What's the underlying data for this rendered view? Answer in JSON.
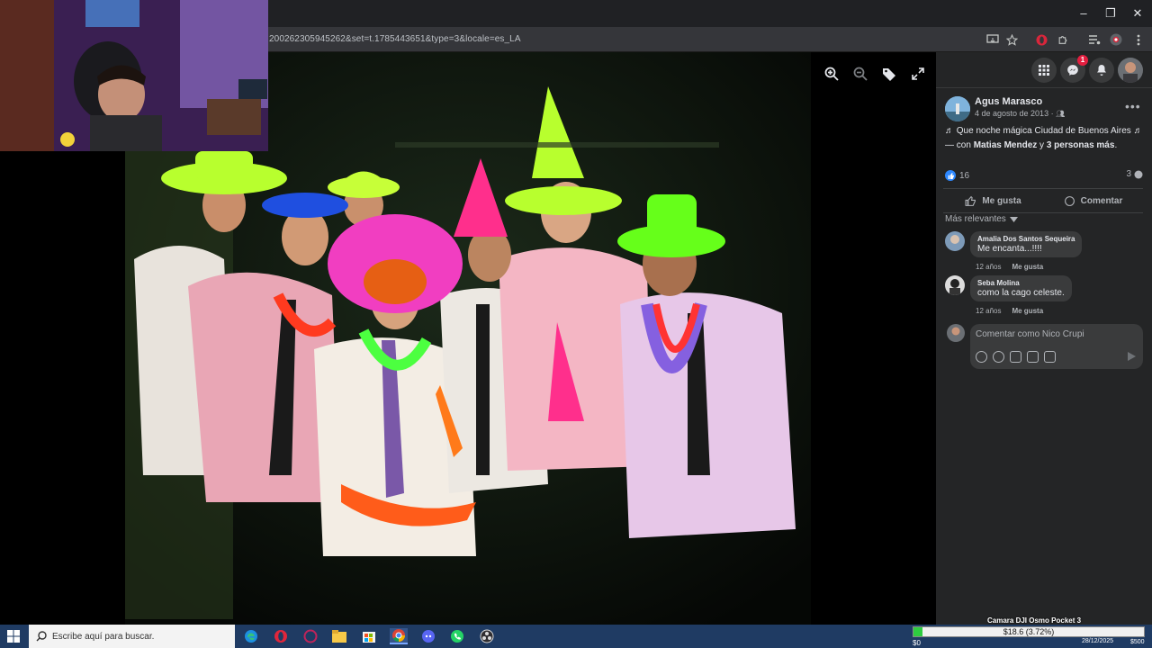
{
  "browser": {
    "url": "200262305945262&set=t.1785443651&type=3&locale=es_LA"
  },
  "viewer": {
    "tools": [
      "zoom-in-icon",
      "zoom-out-icon",
      "tag-icon",
      "fullscreen-icon"
    ]
  },
  "fb_header": {
    "messenger_badge": "1"
  },
  "post": {
    "author": "Agus Marasco",
    "date": "4 de agosto de 2013 · ",
    "text_line1": "♬ Que noche mágica Ciudad de Buenos Aires ♬",
    "text_prefix": "— con ",
    "tag1": "Matias Mendez",
    "text_mid": " y ",
    "tag2": "3 personas más",
    "text_suffix": ".",
    "likes": "16",
    "comments": "3",
    "like_label": "Me gusta",
    "comment_label": "Comentar",
    "sort_label": "Más relevantes"
  },
  "comments": [
    {
      "author": "Amalia Dos Santos Sequeira",
      "text": "Me encanta...!!!!",
      "age": "12 años",
      "like": "Me gusta"
    },
    {
      "author": "Seba Molina",
      "text": "como la cago celeste.",
      "age": "12 años",
      "like": "Me gusta"
    }
  ],
  "compose": {
    "placeholder": "Comentar como Nico Crupi"
  },
  "taskbar": {
    "search_placeholder": "Escribe aquí para buscar.",
    "goal_title": "Camara DJI Osmo Pocket 3",
    "goal_text": "$18.6 (3.72%)",
    "goal_fraction": 0.0372,
    "goal_min": "$0",
    "goal_max": "$500",
    "date": "28/12/2025"
  }
}
